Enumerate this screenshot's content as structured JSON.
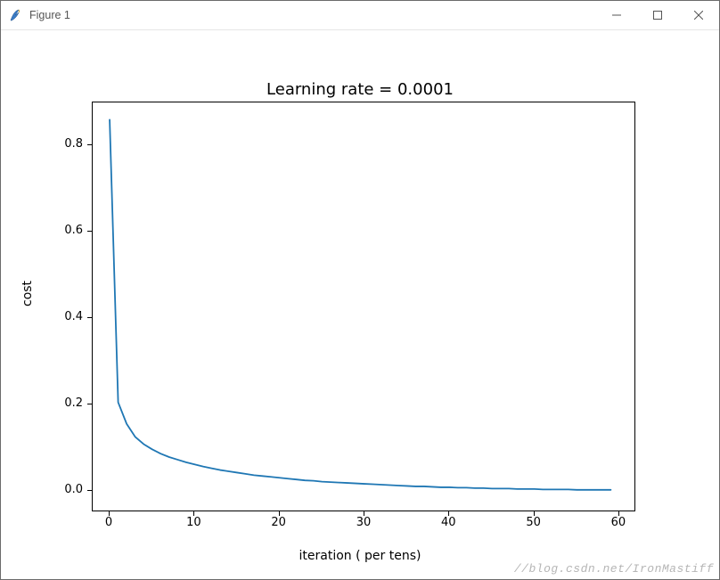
{
  "window": {
    "title": "Figure 1"
  },
  "chart_data": {
    "type": "line",
    "title": "Learning rate = 0.0001",
    "xlabel": "iteration ( per tens)",
    "ylabel": "cost",
    "xlim": [
      -2,
      62
    ],
    "ylim": [
      -0.05,
      0.9
    ],
    "xticks": [
      0,
      10,
      20,
      30,
      40,
      50,
      60
    ],
    "yticks": [
      0.0,
      0.2,
      0.4,
      0.6,
      0.8
    ],
    "series": [
      {
        "name": "cost",
        "color": "#1f77b4",
        "x": [
          0,
          1,
          2,
          3,
          4,
          5,
          6,
          7,
          8,
          9,
          10,
          11,
          12,
          13,
          14,
          15,
          16,
          17,
          18,
          19,
          20,
          21,
          22,
          23,
          24,
          25,
          26,
          27,
          28,
          29,
          30,
          31,
          32,
          33,
          34,
          35,
          36,
          37,
          38,
          39,
          40,
          41,
          42,
          43,
          44,
          45,
          46,
          47,
          48,
          49,
          50,
          51,
          52,
          53,
          54,
          55,
          56,
          57,
          58,
          59
        ],
        "y": [
          0.86,
          0.205,
          0.155,
          0.125,
          0.108,
          0.096,
          0.086,
          0.078,
          0.072,
          0.066,
          0.061,
          0.056,
          0.052,
          0.048,
          0.045,
          0.042,
          0.039,
          0.036,
          0.034,
          0.032,
          0.03,
          0.028,
          0.026,
          0.024,
          0.023,
          0.021,
          0.02,
          0.019,
          0.018,
          0.017,
          0.016,
          0.015,
          0.014,
          0.013,
          0.012,
          0.011,
          0.01,
          0.01,
          0.009,
          0.008,
          0.008,
          0.007,
          0.007,
          0.006,
          0.006,
          0.005,
          0.005,
          0.005,
          0.004,
          0.004,
          0.004,
          0.003,
          0.003,
          0.003,
          0.003,
          0.002,
          0.002,
          0.002,
          0.002,
          0.002
        ]
      }
    ]
  },
  "watermark": "//blog.csdn.net/IronMastiff"
}
